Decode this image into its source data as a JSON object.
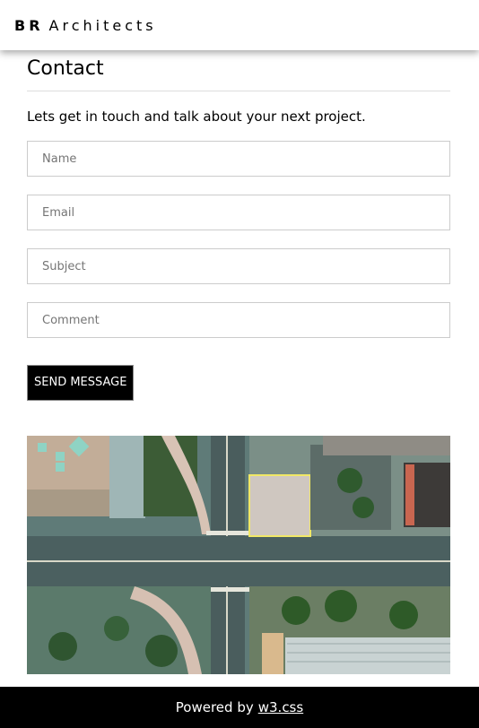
{
  "header": {
    "brand_bold": "BR",
    "brand_rest": "Architects"
  },
  "contact": {
    "title": "Contact",
    "intro": "Lets get in touch and talk about your next project.",
    "name_placeholder": "Name",
    "email_placeholder": "Email",
    "subject_placeholder": "Subject",
    "comment_placeholder": "Comment",
    "send_label": "SEND MESSAGE"
  },
  "image": {
    "icon": "aerial-city-map-image"
  },
  "footer": {
    "prefix": "Powered by",
    "link_label": "w3.css"
  },
  "colors": {
    "footer_bg": "#000000",
    "button_bg": "#000000",
    "field_border": "#cccccc"
  }
}
